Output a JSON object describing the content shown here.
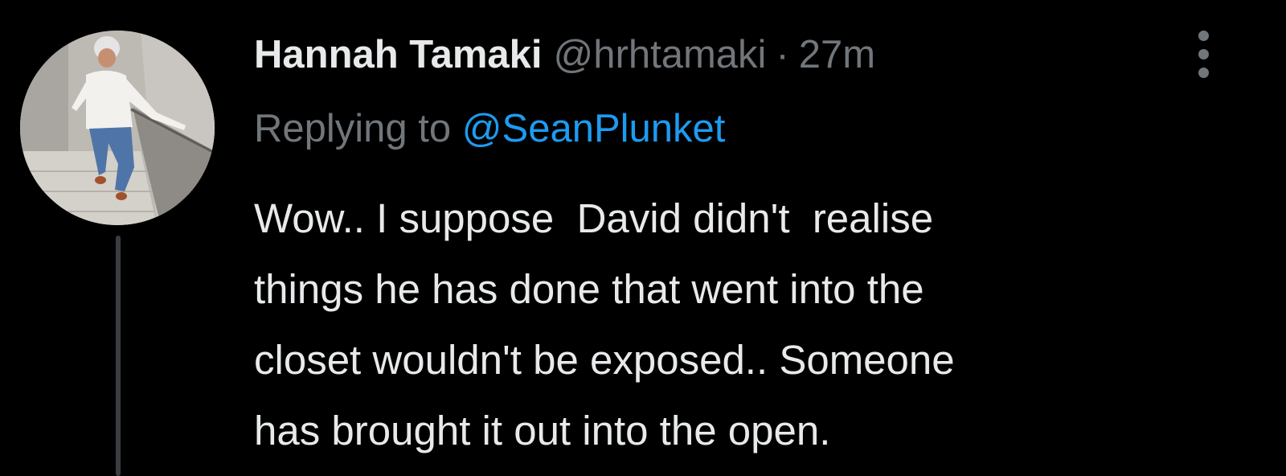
{
  "tweet": {
    "display_name": "Hannah Tamaki",
    "handle": "@hrhtamaki",
    "separator": "·",
    "time": "27m",
    "replying_prefix": "Replying to",
    "replying_to": "@SeanPlunket",
    "text_lines": [
      "Wow.. I suppose  David didn't  realise",
      "things he has done that went into the",
      "closet wouldn't be exposed.. Someone",
      "has brought it out into the open."
    ]
  },
  "icons": {
    "more": "more-vertical-icon",
    "avatar": "profile-photo"
  },
  "colors": {
    "background": "#000000",
    "text_primary": "#e7e9ea",
    "text_secondary": "#71767b",
    "accent": "#1d9bf0",
    "thread_line": "#3a3d41"
  }
}
